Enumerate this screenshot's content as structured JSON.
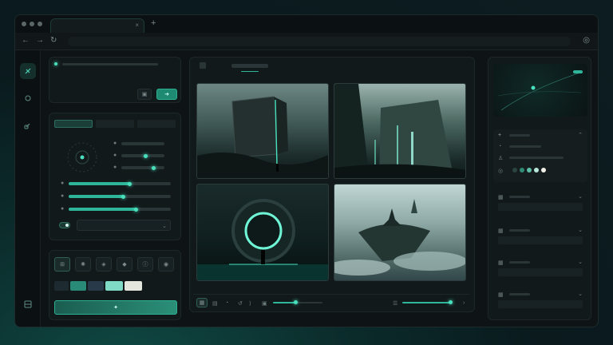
{
  "browser": {
    "tab_close": "×",
    "tab_add": "+",
    "back": "←",
    "forward": "→",
    "reload": "↻",
    "settings": "◎"
  },
  "toolbar": {
    "primary_glyph": "➜",
    "generate_glyph": "✦"
  },
  "styles": {
    "swatches": [
      "#1d2a30",
      "#2a8a78",
      "#28394a",
      "#7fdac6",
      "#e2e6dc"
    ]
  },
  "right_panel": {
    "swatches": [
      "#2b4540",
      "#2f8a76",
      "#5dbfa9",
      "#b7e6da",
      "#f0f0e8"
    ]
  },
  "colors": {
    "accent": "#2fb59a",
    "glow": "#48e0bd",
    "background": "#0e1416"
  },
  "icons": [
    "palette-icon",
    "sparkle-icon",
    "link-icon",
    "layout-icon",
    "image-icon",
    "grid-icon",
    "settings-icon"
  ]
}
